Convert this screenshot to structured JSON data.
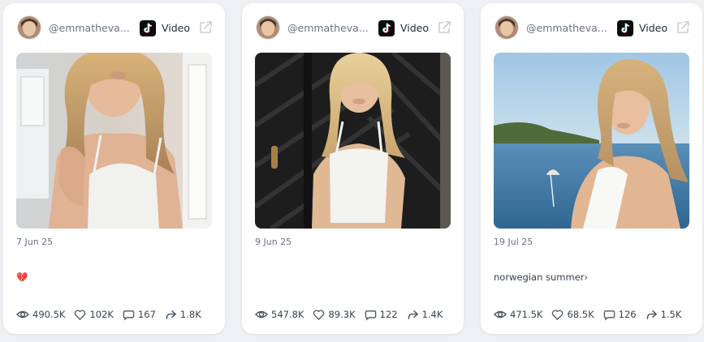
{
  "icons": {
    "tiktok": "tiktok-icon",
    "external": "external-link-icon",
    "views": "eye-icon",
    "likes": "heart-icon",
    "comments": "comment-icon",
    "shares": "share-icon"
  },
  "colors": {
    "stat_icon": "#4b5563",
    "muted": "#6b7280",
    "card": "#ffffff"
  },
  "cards": [
    {
      "handle": "@emmatheva...",
      "type": "Video",
      "date": "7 Jun 25",
      "caption": "💔",
      "stats": {
        "views": "490.5K",
        "likes": "102K",
        "comments": "167",
        "shares": "1.8K"
      }
    },
    {
      "handle": "@emmatheva...",
      "type": "Video",
      "date": "9 Jun 25",
      "caption": "",
      "stats": {
        "views": "547.8K",
        "likes": "89.3K",
        "comments": "122",
        "shares": "1.4K"
      }
    },
    {
      "handle": "@emmatheva...",
      "type": "Video",
      "date": "19 Jul 25",
      "caption": "norwegian summer›",
      "stats": {
        "views": "471.5K",
        "likes": "68.5K",
        "comments": "126",
        "shares": "1.5K"
      }
    }
  ]
}
